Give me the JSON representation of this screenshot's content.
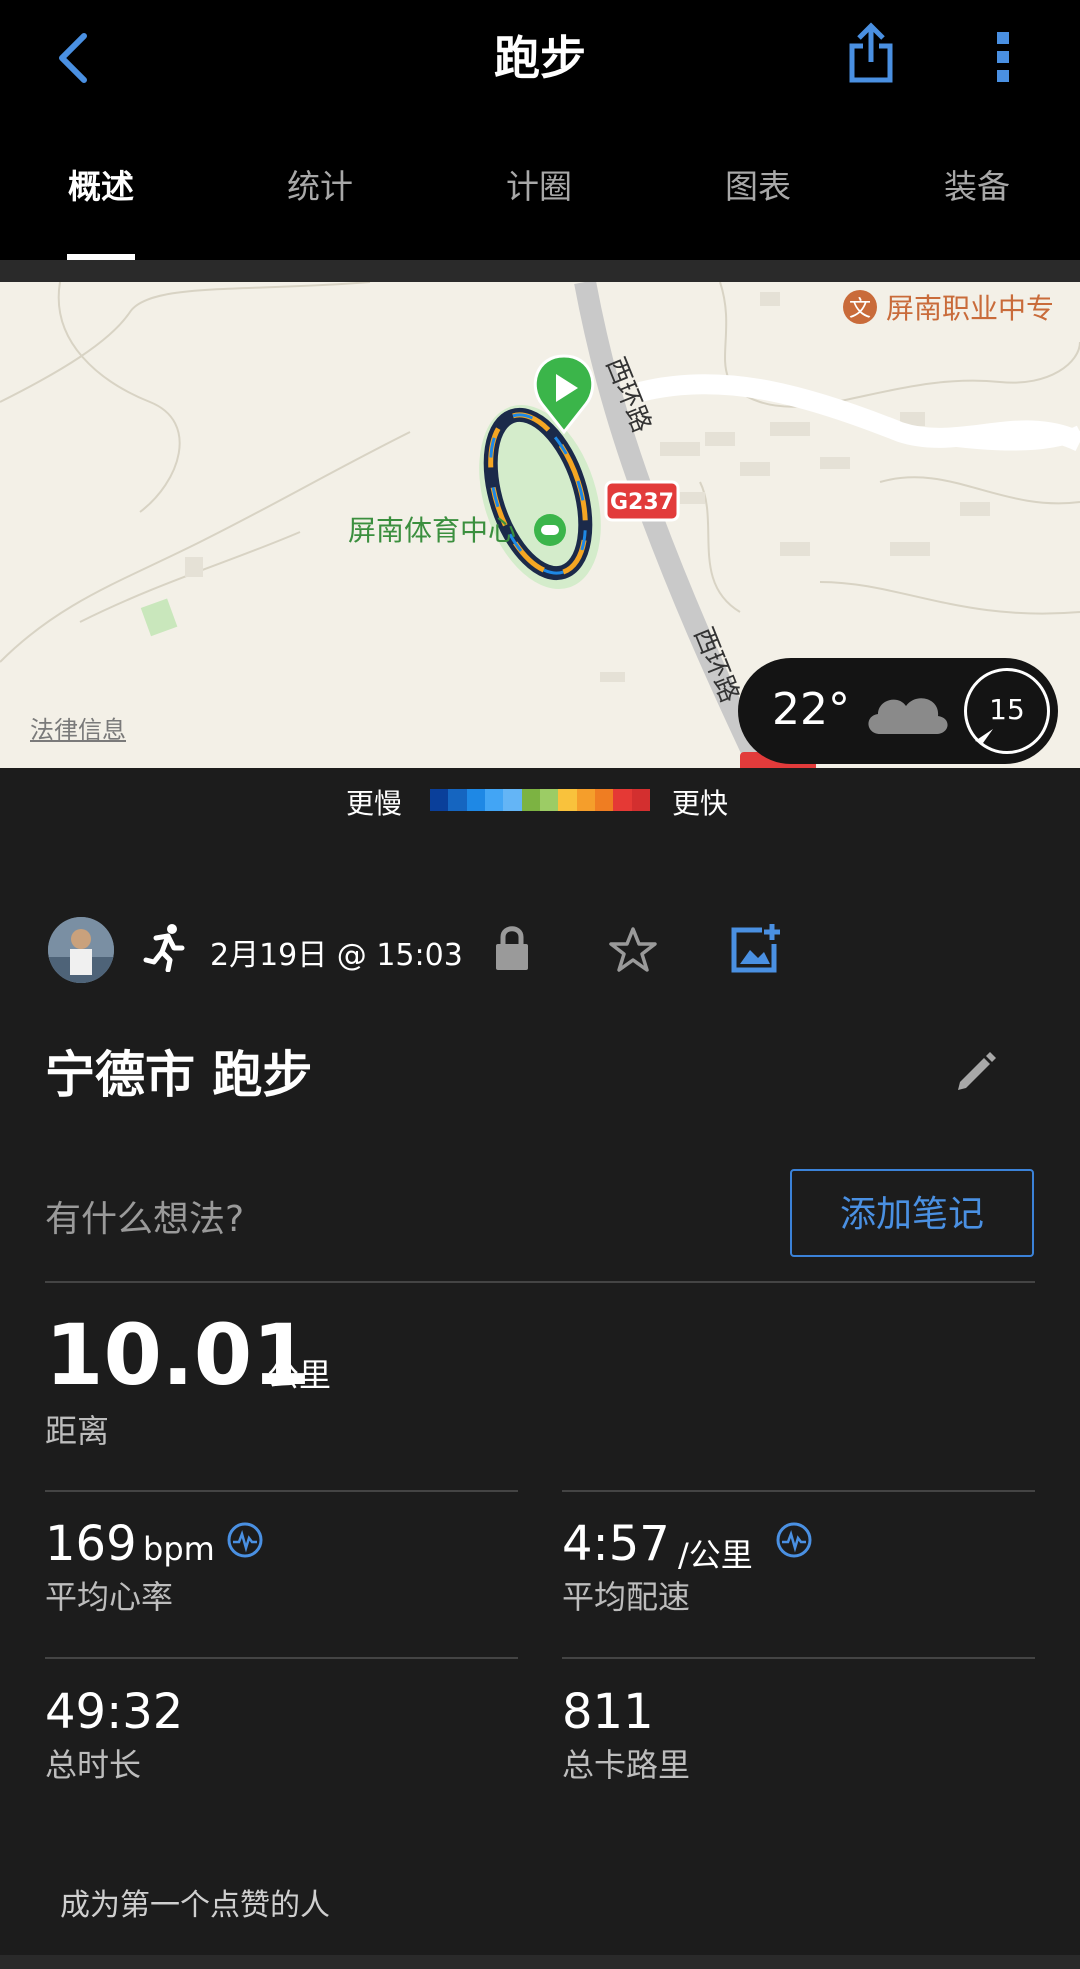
{
  "header": {
    "title": "跑步",
    "tabs": [
      {
        "label": "概述",
        "active": true
      },
      {
        "label": "统计",
        "active": false
      },
      {
        "label": "计圈",
        "active": false
      },
      {
        "label": "图表",
        "active": false
      },
      {
        "label": "装备",
        "active": false
      }
    ]
  },
  "map": {
    "labels": {
      "road_1": "西环路",
      "road_2": "西环路",
      "highway": "G237",
      "venue": "屏南体育中心",
      "school": "屏南职业中专"
    },
    "legal": "法律信息",
    "weather": {
      "temperature": "22°",
      "wind": "15",
      "icon": "cloud-icon"
    }
  },
  "legend": {
    "slow": "更慢",
    "fast": "更快",
    "colors": [
      "#0a3f9a",
      "#1565c0",
      "#1e88e5",
      "#42a5f5",
      "#64b5f6",
      "#7cb342",
      "#9ccc65",
      "#f9c23c",
      "#f59e2b",
      "#ef7d22",
      "#e53935",
      "#d32f2f"
    ]
  },
  "activity": {
    "date": "2月19日 @ 15:03",
    "title": "宁德市 跑步",
    "notes_placeholder": "有什么想法?",
    "add_note": "添加笔记"
  },
  "stats": {
    "distance": {
      "value": "10.01",
      "unit": "公里",
      "label": "距离"
    },
    "avg_hr": {
      "value": "169",
      "unit": "bpm",
      "label": "平均心率"
    },
    "avg_pace": {
      "value": "4:57",
      "unit": "/公里",
      "label": "平均配速"
    },
    "duration": {
      "value": "49:32",
      "label": "总时长"
    },
    "calories": {
      "value": "811",
      "label": "总卡路里"
    }
  },
  "likes": "成为第一个点赞的人",
  "colors": {
    "accent": "#4a90e2",
    "background": "#1c1c1c",
    "header": "#000000",
    "start_marker": "#3bb54a"
  }
}
